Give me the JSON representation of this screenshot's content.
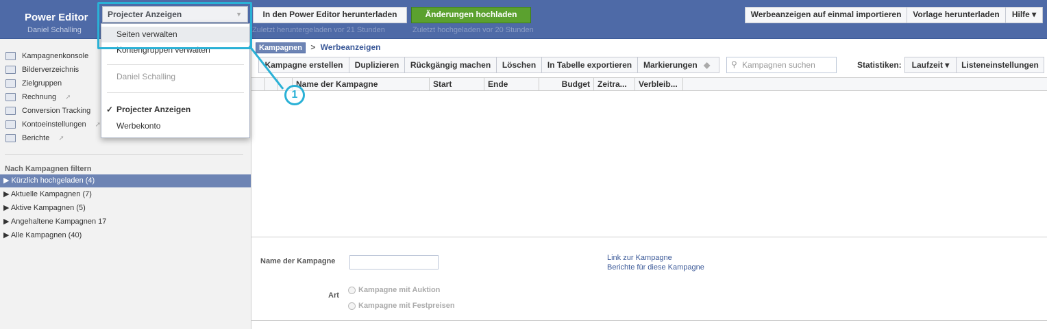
{
  "header": {
    "app_title": "Power Editor",
    "user_name": "Daniel Schalling",
    "account_select": "Projecter Anzeigen",
    "download_btn": "In den Power Editor herunterladen",
    "download_note": "Zuletzt heruntergeladen vor 21 Stunden",
    "upload_btn": "Änderungen hochladen",
    "upload_note": "Zuletzt hochgeladen vor 20 Stunden",
    "import_btn": "Werbeanzeigen auf einmal importieren",
    "template_btn": "Vorlage herunterladen",
    "help_btn": "Hilfe ▾"
  },
  "dropdown": {
    "items": [
      "Seiten verwalten",
      "Kontengruppen verwalten",
      "Daniel Schalling",
      "Projecter Anzeigen",
      "Werbekonto"
    ],
    "checkmark": "✓"
  },
  "sidebar": {
    "items": [
      {
        "label": "Kampagnenkonsole",
        "icon": "console-icon"
      },
      {
        "label": "Bilderverzeichnis",
        "icon": "images-icon"
      },
      {
        "label": "Zielgruppen",
        "icon": "audience-icon"
      },
      {
        "label": "Rechnung",
        "icon": "billing-icon"
      },
      {
        "label": "Conversion Tracking",
        "icon": "conversion-icon"
      },
      {
        "label": "Kontoeinstellungen",
        "icon": "settings-icon"
      },
      {
        "label": "Berichte",
        "icon": "reports-icon"
      }
    ],
    "filter_heading": "Nach Kampagnen filtern",
    "filters": [
      "▶ Kürzlich hochgeladen (4)",
      "▶ Aktuelle Kampagnen (7)",
      "▶ Aktive Kampagnen (5)",
      "▶ Angehaltene Kampagnen 17",
      "▶ Alle Kampagnen (40)"
    ]
  },
  "breadcrumb": {
    "current": "Kampagnen",
    "sep": ">",
    "next": "Werbeanzeigen"
  },
  "toolbar": {
    "create": "Kampagne erstellen",
    "duplicate": "Duplizieren",
    "undo": "Rückgängig machen",
    "delete": "Löschen",
    "export": "In Tabelle exportieren",
    "tags": "Markierungen",
    "search_placeholder": "Kampagnen suchen",
    "stats_label": "Statistiken:",
    "runtime": "Laufzeit ▾",
    "list_settings": "Listeneinstellungen"
  },
  "grid": {
    "columns": [
      "Name der Kampagne",
      "Start",
      "Ende",
      "Budget",
      "Zeitra...",
      "Verbleib..."
    ]
  },
  "detail": {
    "name_label": "Name der Kampagne",
    "type_label": "Art",
    "radio_auction": "Kampagne mit Auktion",
    "radio_fixed": "Kampagne mit Festpreisen",
    "link_campaign": "Link zur Kampagne",
    "link_reports": "Berichte für diese Kampagne"
  },
  "callout": {
    "number": "1"
  },
  "colors": {
    "accent": "#2ab1d6",
    "header": "#4e6aa7",
    "green": "#5ba12f"
  }
}
